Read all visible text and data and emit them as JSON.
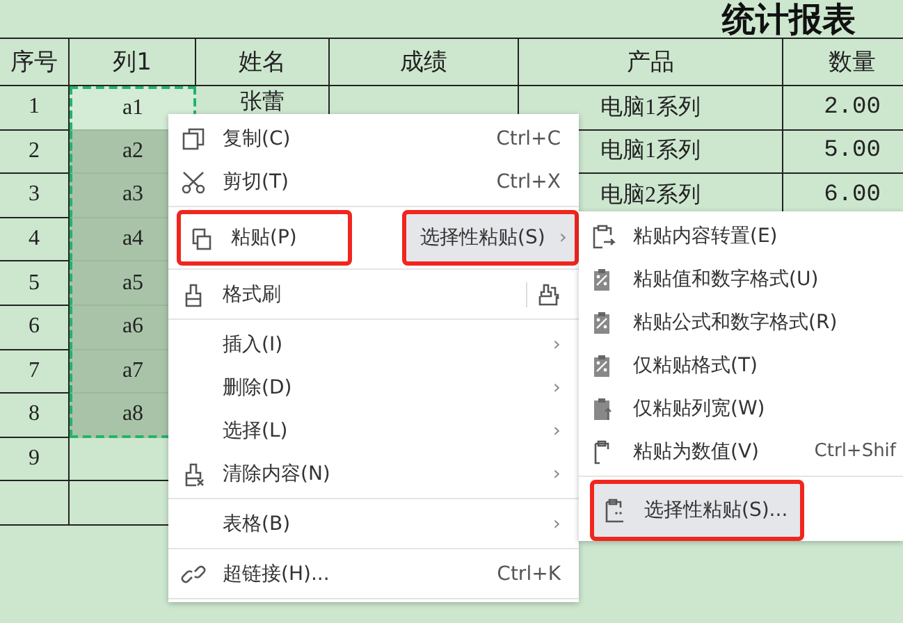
{
  "title": "统计报表",
  "table": {
    "columns": [
      "序号",
      "列1",
      "姓名",
      "成绩",
      "产品",
      "数量"
    ],
    "rows": [
      {
        "no": "1",
        "col1": "a1",
        "name": "张蕾",
        "product": "电脑1系列",
        "qty": "2.00",
        "selected": true,
        "active": true
      },
      {
        "no": "2",
        "col1": "a2",
        "product": "电脑1系列",
        "qty": "5.00",
        "selected": true,
        "active": false
      },
      {
        "no": "3",
        "col1": "a3",
        "product": "电脑2系列",
        "qty": "6.00",
        "selected": true,
        "active": false
      },
      {
        "no": "4",
        "col1": "a4",
        "selected": true,
        "active": false
      },
      {
        "no": "5",
        "col1": "a5",
        "selected": true,
        "active": false
      },
      {
        "no": "6",
        "col1": "a6",
        "selected": true,
        "active": false
      },
      {
        "no": "7",
        "col1": "a7",
        "selected": true,
        "active": false
      },
      {
        "no": "8",
        "col1": "a8",
        "selected": true,
        "active": false
      },
      {
        "no": "9",
        "selected": false
      },
      {
        "selected": false
      }
    ]
  },
  "context_menu": {
    "items": [
      {
        "kind": "item",
        "label": "复制(C)",
        "shortcut": "Ctrl+C",
        "selected": false,
        "annotated": false
      },
      {
        "kind": "item",
        "label": "剪切(T)",
        "shortcut": "Ctrl+X",
        "selected": false,
        "annotated": false
      },
      {
        "kind": "separator"
      },
      {
        "kind": "split",
        "label": "粘贴(P)",
        "annotated": true,
        "side": {
          "label": "选择性粘贴(S)",
          "arrow": "›",
          "selected": true,
          "annotated": true
        }
      },
      {
        "kind": "separator"
      },
      {
        "kind": "tool",
        "label": "格式刷",
        "selected": false,
        "annotated": false
      },
      {
        "kind": "separator"
      },
      {
        "kind": "item",
        "label": "插入(I)",
        "arrow": "›",
        "selected": false,
        "annotated": false
      },
      {
        "kind": "item",
        "label": "删除(D)",
        "arrow": "›",
        "selected": false,
        "annotated": false
      },
      {
        "kind": "item",
        "label": "选择(L)",
        "arrow": "›",
        "selected": false,
        "annotated": false
      },
      {
        "kind": "item",
        "label": "清除内容(N)",
        "arrow": "›",
        "selected": false,
        "annotated": false
      },
      {
        "kind": "separator"
      },
      {
        "kind": "item",
        "label": "表格(B)",
        "arrow": "›",
        "selected": false,
        "annotated": false
      },
      {
        "kind": "separator"
      },
      {
        "kind": "item",
        "label": "超链接(H)...",
        "shortcut": "Ctrl+K",
        "selected": false,
        "annotated": false
      },
      {
        "kind": "separator"
      }
    ]
  },
  "paste_submenu": {
    "items": [
      {
        "kind": "item",
        "label": "粘贴内容转置(E)",
        "selected": false,
        "annotated": false
      },
      {
        "kind": "item",
        "label": "粘贴值和数字格式(U)",
        "selected": false,
        "annotated": false
      },
      {
        "kind": "item",
        "label": "粘贴公式和数字格式(R)",
        "selected": false,
        "annotated": false
      },
      {
        "kind": "item",
        "label": "仅粘贴格式(T)",
        "selected": false,
        "annotated": false
      },
      {
        "kind": "item",
        "label": "仅粘贴列宽(W)",
        "selected": false,
        "annotated": false
      },
      {
        "kind": "item",
        "label": "粘贴为数值(V)",
        "shortcut": "Ctrl+Shif",
        "selected": false,
        "annotated": false
      },
      {
        "kind": "separator"
      },
      {
        "kind": "item",
        "label": "选择性粘贴(S)...",
        "selected": true,
        "annotated": true
      }
    ]
  }
}
